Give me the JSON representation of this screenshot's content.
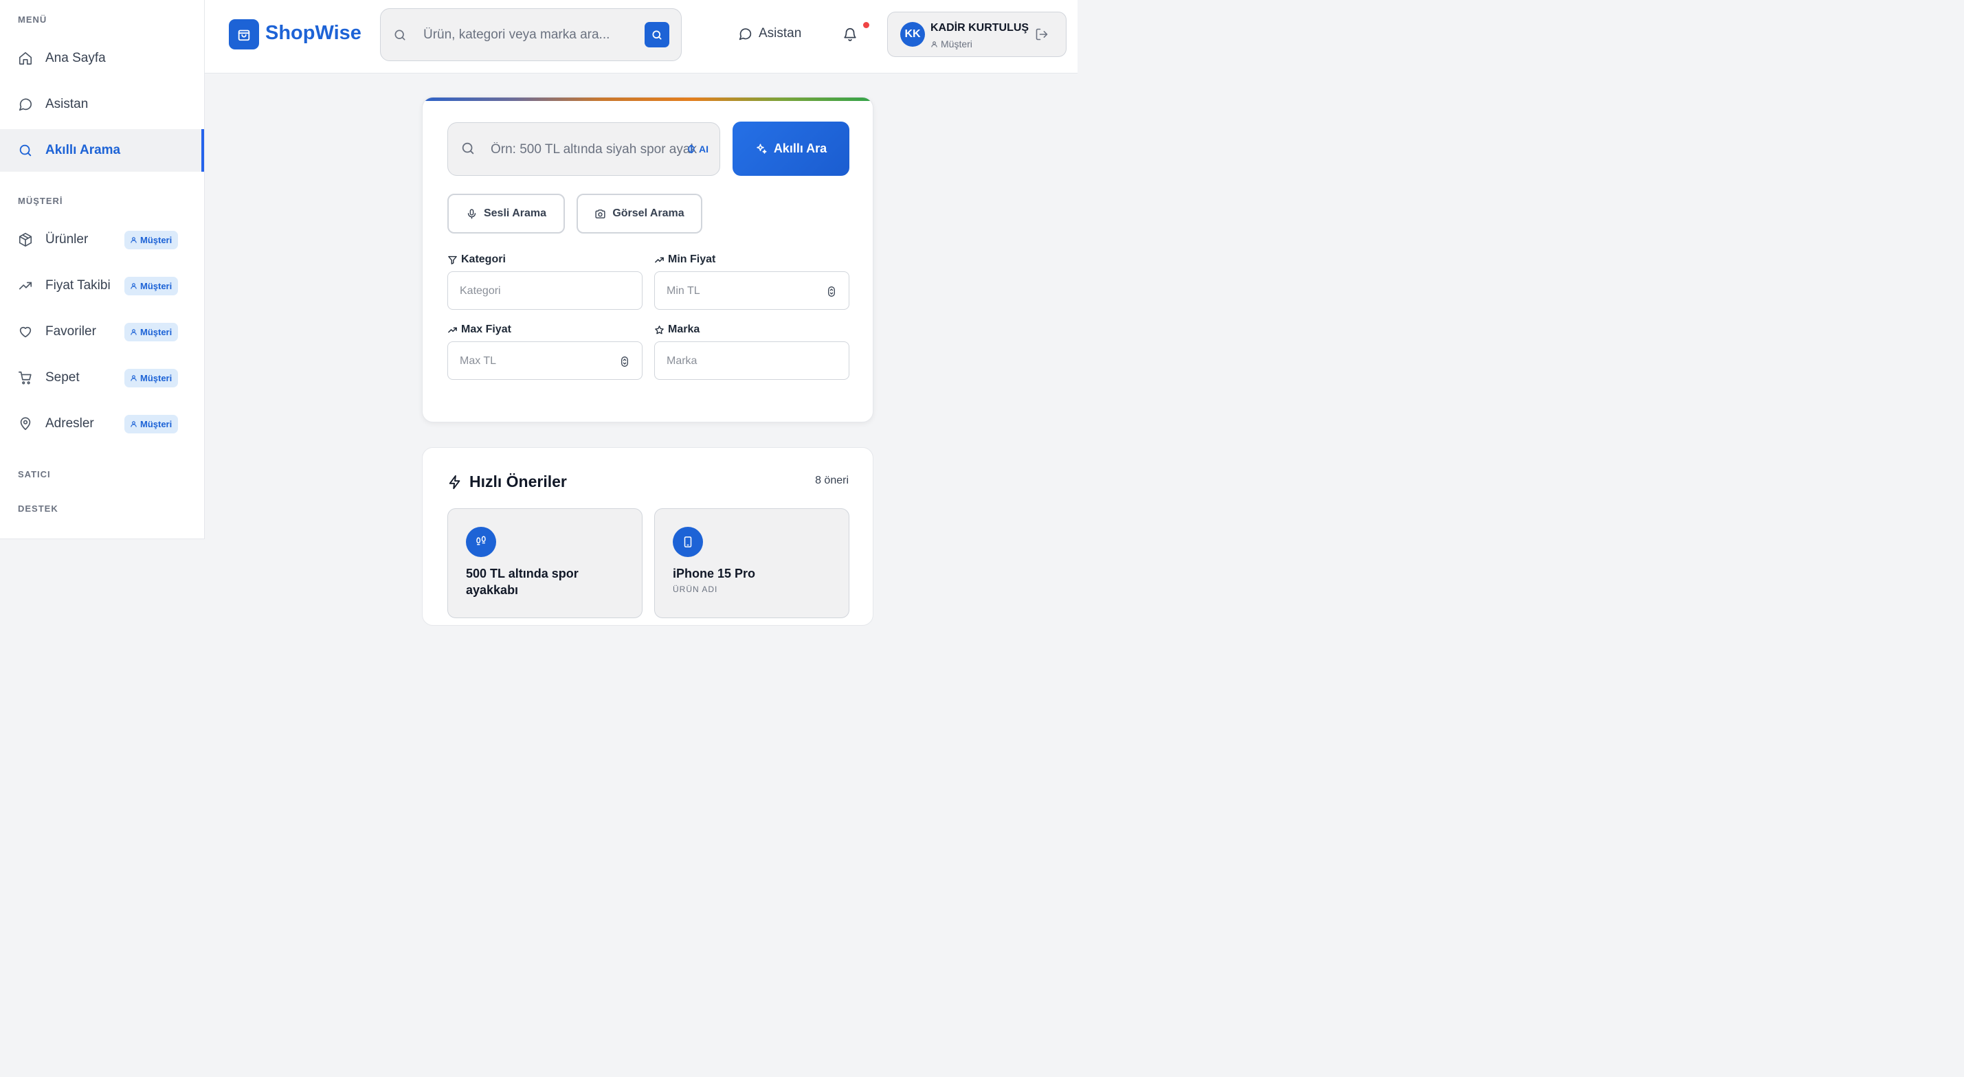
{
  "sidebar": {
    "sections": {
      "menu": "MENÜ",
      "customer": "MÜŞTERİ",
      "seller": "SATICI",
      "support": "DESTEK"
    },
    "items": [
      {
        "label": "Ana Sayfa",
        "icon": "home-icon"
      },
      {
        "label": "Asistan",
        "icon": "chat-icon"
      },
      {
        "label": "Akıllı Arama",
        "icon": "search-icon",
        "active": true
      },
      {
        "label": "Ürünler",
        "icon": "box-icon",
        "badge": "Müşteri"
      },
      {
        "label": "Fiyat Takibi",
        "icon": "trending-up-icon",
        "badge": "Müşteri"
      },
      {
        "label": "Favoriler",
        "icon": "heart-icon",
        "badge": "Müşteri"
      },
      {
        "label": "Sepet",
        "icon": "cart-icon",
        "badge": "Müşteri"
      },
      {
        "label": "Adresler",
        "icon": "map-pin-icon",
        "badge": "Müşteri"
      }
    ]
  },
  "header": {
    "brand": "ShopWise",
    "search_placeholder": "Ürün, kategori veya marka ara...",
    "assistant_label": "Asistan",
    "user": {
      "initials": "KK",
      "name": "KADİR KURTULUŞ",
      "role": "Müşteri"
    }
  },
  "smart_search": {
    "placeholder": "Örn: 500 TL altında siyah spor ayakkabı",
    "ai_tag": "AI",
    "button_label": "Akıllı Ara",
    "voice_label": "Sesli Arama",
    "image_label": "Görsel Arama",
    "filters": {
      "category_label": "Kategori",
      "category_placeholder": "Kategori",
      "min_label": "Min Fiyat",
      "min_placeholder": "Min TL",
      "max_label": "Max Fiyat",
      "max_placeholder": "Max TL",
      "brand_label": "Marka",
      "brand_placeholder": "Marka"
    }
  },
  "suggestions": {
    "title": "Hızlı Öneriler",
    "count": "8 öneri",
    "items": [
      {
        "text": "500 TL altında spor ayakkabı",
        "icon": "footprints-icon"
      },
      {
        "text": "iPhone 15 Pro",
        "sub": "ÜRÜN ADI",
        "icon": "smartphone-icon"
      }
    ]
  },
  "colors": {
    "accent": "#1d63d6",
    "background": "#f3f4f6",
    "badge_bg": "#dcebfb",
    "notification": "#ef4444"
  }
}
